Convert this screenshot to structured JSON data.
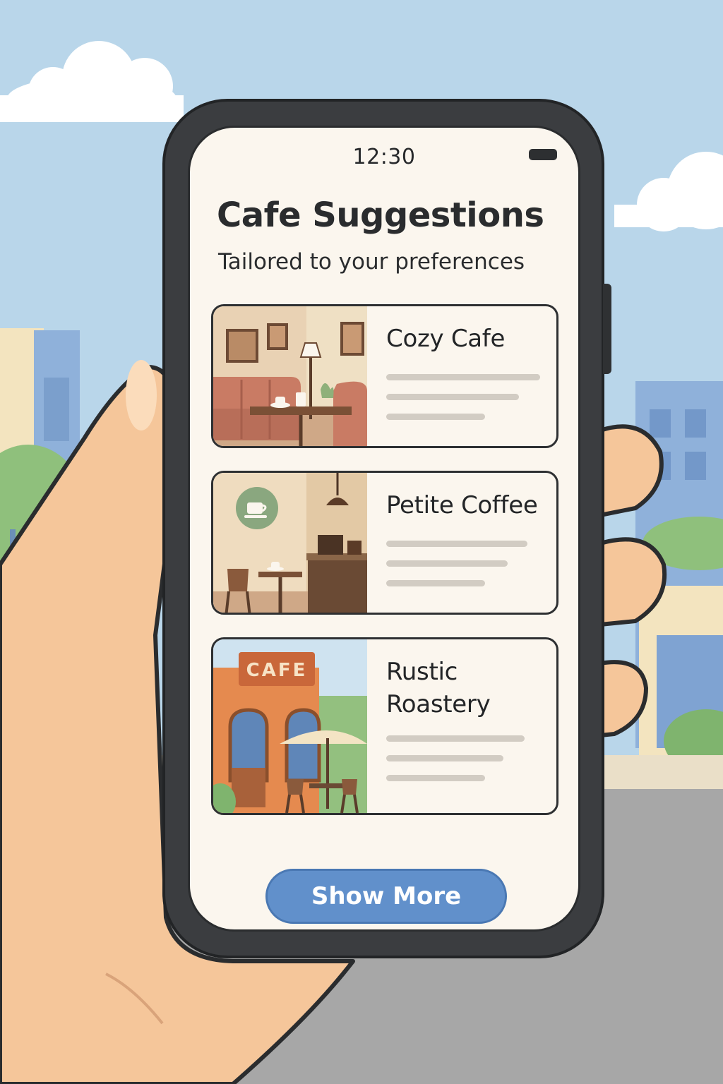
{
  "status_bar": {
    "time": "12:30",
    "battery_icon": "battery-icon"
  },
  "header": {
    "title": "Cafe Suggestions",
    "subtitle": "Tailored to your preferences"
  },
  "cafes": [
    {
      "name": "Cozy Cafe",
      "image": "cozy-cafe-interior-image"
    },
    {
      "name": "Petite Coffee",
      "image": "petite-coffee-interior-image"
    },
    {
      "name_lines": [
        "Rustic",
        "Roastery"
      ],
      "image": "rustic-roastery-storefront-image",
      "sign_text": "CAFE"
    }
  ],
  "actions": {
    "show_more_label": "Show More"
  },
  "colors": {
    "sky": "#b9d6ea",
    "screen_background": "#fbf6ee",
    "button": "#6190cb",
    "text": "#2a2c2e",
    "placeholder_line": "#d2ccc3"
  }
}
